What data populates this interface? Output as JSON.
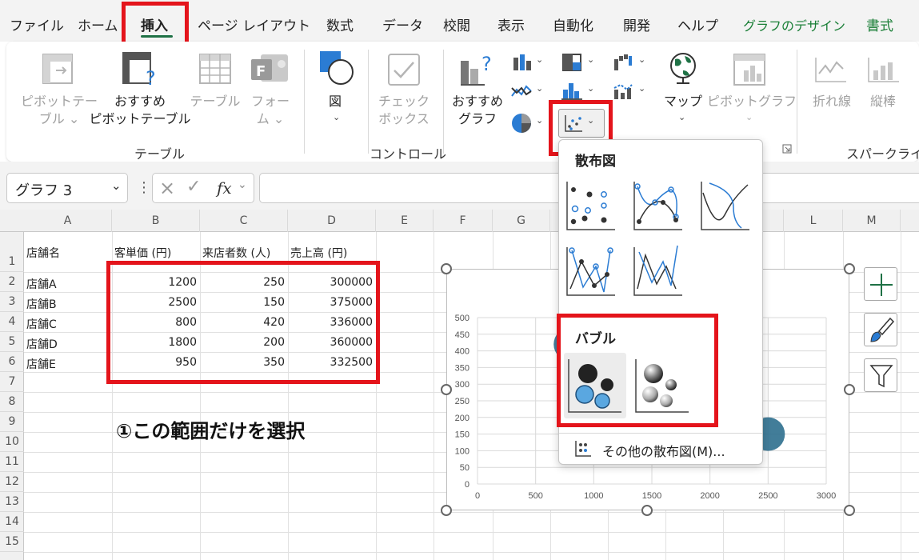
{
  "tabs": [
    "ファイル",
    "ホーム",
    "挿入",
    "ページ レイアウト",
    "数式",
    "データ",
    "校閲",
    "表示",
    "自動化",
    "開発",
    "ヘルプ",
    "グラフのデザイン",
    "書式"
  ],
  "ribbon": {
    "pivot_table": [
      "ピボットテー",
      "ブル ⌄"
    ],
    "recommended_pivot": [
      "おすすめ",
      "ピボットテーブル"
    ],
    "table": "テーブル",
    "forms": [
      "フォー",
      "ム ⌄"
    ],
    "illustrations": "図",
    "checkbox": [
      "チェック",
      "ボックス"
    ],
    "recommended_charts": [
      "おすすめ",
      "グラフ"
    ],
    "maps": "マップ",
    "pivot_chart": "ピボットグラフ",
    "spark_line": "折れ線",
    "spark_column": "縦棒",
    "group_table": "テーブル",
    "group_control": "コントロール",
    "group_sparklines": "スパークライン"
  },
  "formula_bar": {
    "name_box": "グラフ 3",
    "fx": "fx"
  },
  "columns": [
    "A",
    "B",
    "C",
    "D",
    "E",
    "F",
    "G",
    "H",
    "I",
    "J",
    "K",
    "L",
    "M"
  ],
  "rows": [
    "1",
    "2",
    "3",
    "4",
    "5",
    "6",
    "7",
    "8",
    "9",
    "10",
    "11",
    "12",
    "13",
    "14",
    "15"
  ],
  "table": {
    "headers": [
      "店舗名",
      "客単価 (円)",
      "来店者数 (人)",
      "売上高 (円)"
    ],
    "rows": [
      [
        "店舗A",
        "1200",
        "250",
        "300000"
      ],
      [
        "店舗B",
        "2500",
        "150",
        "375000"
      ],
      [
        "店舗C",
        "800",
        "420",
        "336000"
      ],
      [
        "店舗D",
        "1800",
        "200",
        "360000"
      ],
      [
        "店舗E",
        "950",
        "350",
        "332500"
      ]
    ]
  },
  "annotation": "①この範囲だけを選択",
  "dropdown": {
    "scatter_heading": "散布図",
    "bubble_heading": "バブル",
    "more_label": "その他の散布図(M)..."
  },
  "colors": {
    "accent_red": "#e4141b",
    "excel_green": "#1e7145",
    "bubble_blue": "#2e6f8e",
    "bubble_light": "#5aa7e0"
  },
  "chart_data": {
    "type": "scatter",
    "title": "",
    "xlabel": "",
    "ylabel": "",
    "xlim": [
      0,
      3000
    ],
    "ylim": [
      0,
      500
    ],
    "x_ticks": [
      "0",
      "500",
      "1000",
      "1500",
      "2000",
      "2500",
      "3000"
    ],
    "y_ticks": [
      "0",
      "50",
      "100",
      "150",
      "200",
      "250",
      "300",
      "350",
      "400",
      "450",
      "500"
    ],
    "visible_points": [
      {
        "x": 800,
        "y": 420
      },
      {
        "x": 2500,
        "y": 150
      }
    ],
    "grid": true
  }
}
